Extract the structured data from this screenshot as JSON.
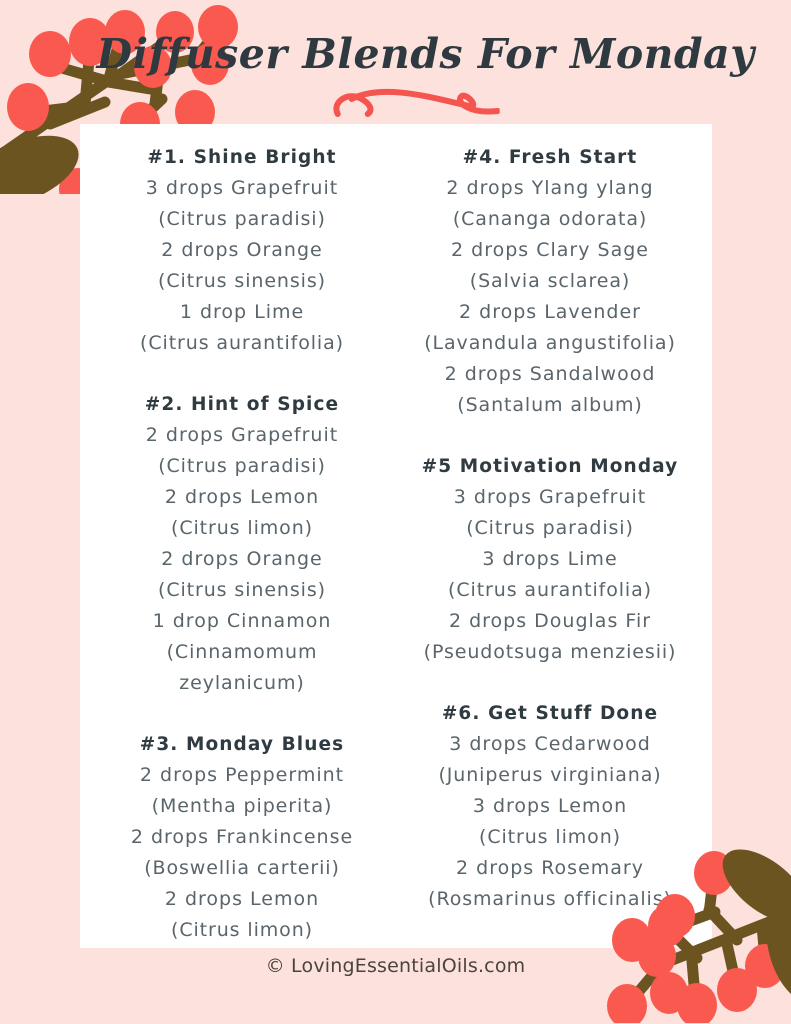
{
  "header": {
    "title": "Diffuser Blends For Monday",
    "swirl_icon": "flourish-swirl-icon",
    "branch_icon_top_left": "berry-branch-icon",
    "branch_icon_bottom_right": "berry-branch-icon"
  },
  "colors": {
    "background_pink": "#fde1dd",
    "card_white": "#ffffff",
    "berry_red": "#f9594f",
    "branch_brown": "#6b5420",
    "title_dark": "#2e3a40",
    "body_gray": "#5a656b",
    "heading_gray": "#2f3b41",
    "footer_brown": "#4b4340"
  },
  "columns": [
    {
      "blends": [
        {
          "title": "#1. Shine Bright",
          "lines": [
            {
              "text": "3 drops Grapefruit",
              "latin": false
            },
            {
              "text": "(Citrus paradisi)",
              "latin": true
            },
            {
              "text": "2 drops Orange",
              "latin": false
            },
            {
              "text": "(Citrus sinensis)",
              "latin": true
            },
            {
              "text": "1 drop Lime",
              "latin": false
            },
            {
              "text": "(Citrus aurantifolia)",
              "latin": true
            }
          ]
        },
        {
          "title": "#2. Hint of Spice",
          "lines": [
            {
              "text": "2 drops Grapefruit",
              "latin": false
            },
            {
              "text": "(Citrus paradisi)",
              "latin": true
            },
            {
              "text": "2 drops Lemon",
              "latin": false
            },
            {
              "text": "(Citrus limon)",
              "latin": true
            },
            {
              "text": "2 drops Orange",
              "latin": false
            },
            {
              "text": "(Citrus sinensis)",
              "latin": true
            },
            {
              "text": "1 drop Cinnamon",
              "latin": false
            },
            {
              "text": "(Cinnamomum",
              "latin": true
            },
            {
              "text": "zeylanicum)",
              "latin": true
            }
          ]
        },
        {
          "title": "#3. Monday Blues",
          "lines": [
            {
              "text": "2 drops Peppermint",
              "latin": false
            },
            {
              "text": "(Mentha piperita)",
              "latin": true
            },
            {
              "text": "2 drops Frankincense",
              "latin": false
            },
            {
              "text": "(Boswellia carterii)",
              "latin": true
            },
            {
              "text": "2 drops Lemon",
              "latin": false
            },
            {
              "text": "(Citrus limon)",
              "latin": true
            }
          ]
        }
      ]
    },
    {
      "blends": [
        {
          "title": "#4. Fresh Start",
          "lines": [
            {
              "text": "2 drops Ylang ylang",
              "latin": false
            },
            {
              "text": "(Cananga odorata)",
              "latin": true
            },
            {
              "text": "2 drops Clary Sage",
              "latin": false
            },
            {
              "text": "(Salvia sclarea)",
              "latin": true
            },
            {
              "text": "2 drops Lavender",
              "latin": false
            },
            {
              "text": "(Lavandula angustifolia)",
              "latin": true
            },
            {
              "text": "2 drops Sandalwood",
              "latin": false
            },
            {
              "text": "(Santalum album)",
              "latin": true
            }
          ]
        },
        {
          "title": "#5 Motivation Monday",
          "lines": [
            {
              "text": "3 drops Grapefruit",
              "latin": false
            },
            {
              "text": "(Citrus paradisi)",
              "latin": true
            },
            {
              "text": "3 drops Lime",
              "latin": false
            },
            {
              "text": "(Citrus aurantifolia)",
              "latin": true
            },
            {
              "text": "2 drops Douglas Fir",
              "latin": false
            },
            {
              "text": "(Pseudotsuga menziesii)",
              "latin": true
            }
          ]
        },
        {
          "title": "#6. Get Stuff Done",
          "lines": [
            {
              "text": "3 drops Cedarwood",
              "latin": false
            },
            {
              "text": "(Juniperus virginiana)",
              "latin": true
            },
            {
              "text": "3 drops Lemon",
              "latin": false
            },
            {
              "text": "(Citrus limon)",
              "latin": true
            },
            {
              "text": "2 drops Rosemary",
              "latin": false
            },
            {
              "text": "(Rosmarinus officinalis)",
              "latin": true
            }
          ]
        }
      ]
    }
  ],
  "footer": {
    "text": "© LovingEssentialOils.com"
  }
}
